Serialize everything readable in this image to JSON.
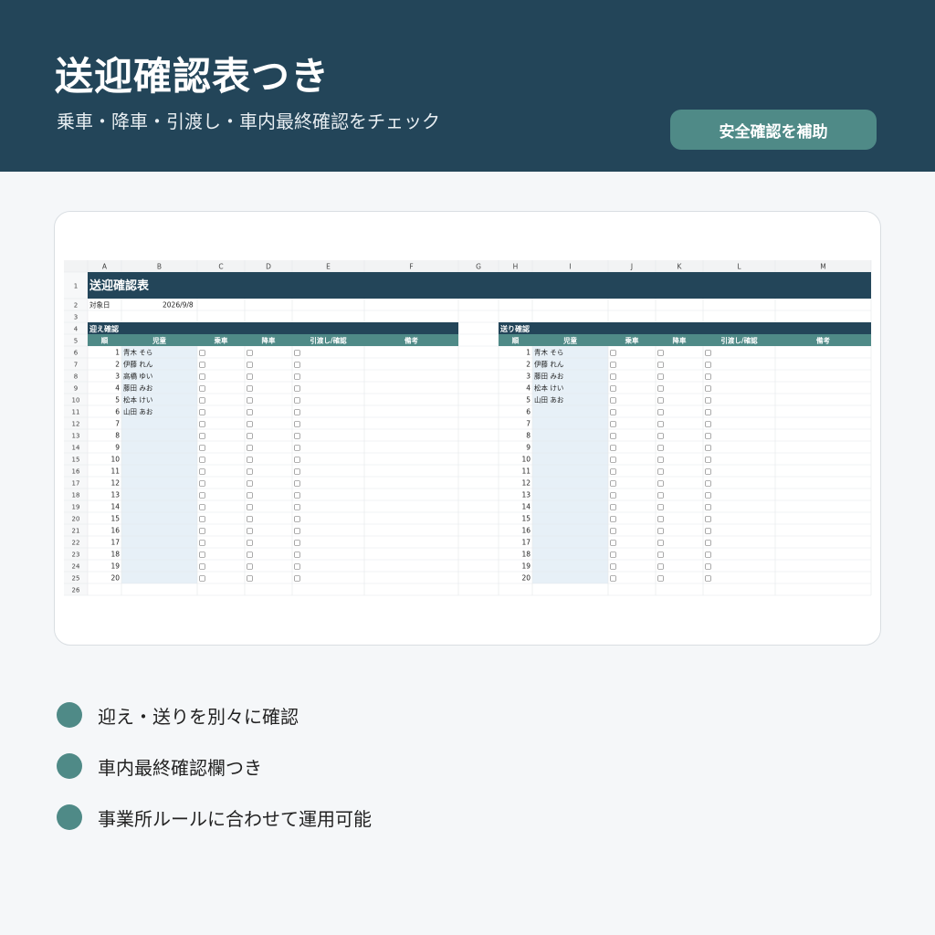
{
  "header": {
    "title": "送迎確認表つき",
    "subtitle": "乗車・降車・引渡し・車内最終確認をチェック",
    "cta_label": "安全確認を補助"
  },
  "sheet": {
    "columns": [
      "A",
      "B",
      "C",
      "D",
      "E",
      "F",
      "G",
      "H",
      "I",
      "J",
      "K",
      "L",
      "M"
    ],
    "title": "送迎確認表",
    "date_label": "対象日",
    "date_value": "2026/9/8",
    "pickup_title": "迎え確認",
    "dropoff_title": "送り確認",
    "headers": [
      "順",
      "児童",
      "乗車",
      "降車",
      "引渡し/確認",
      "備考"
    ],
    "checkbox": "□",
    "pickup_children": [
      "青木 そら",
      "伊藤 れん",
      "高橋 ゆい",
      "藤田 みお",
      "松本 けい",
      "山田 あお"
    ],
    "dropoff_children": [
      "青木 そら",
      "伊藤 れん",
      "藤田 みお",
      "松本 けい",
      "山田 あお"
    ],
    "order_numbers": [
      "1",
      "2",
      "3",
      "4",
      "5",
      "6",
      "7",
      "8",
      "9",
      "10",
      "11",
      "12",
      "13",
      "14",
      "15",
      "16",
      "17",
      "18",
      "19",
      "20"
    ],
    "row_numbers": [
      "1",
      "2",
      "3",
      "4",
      "5",
      "6",
      "7",
      "8",
      "9",
      "10",
      "11",
      "12",
      "13",
      "14",
      "15",
      "16",
      "17",
      "18",
      "19",
      "20",
      "21",
      "22",
      "23",
      "24",
      "25",
      "26"
    ],
    "colors": {
      "navy": "#234559",
      "teal": "#4f8a87",
      "name_fill": "#e7f0f7"
    }
  },
  "features": [
    {
      "icon": "bullet-dot-icon",
      "text": "迎え・送りを別々に確認"
    },
    {
      "icon": "bullet-dot-icon",
      "text": "車内最終確認欄つき"
    },
    {
      "icon": "bullet-dot-icon",
      "text": "事業所ルールに合わせて運用可能"
    }
  ]
}
